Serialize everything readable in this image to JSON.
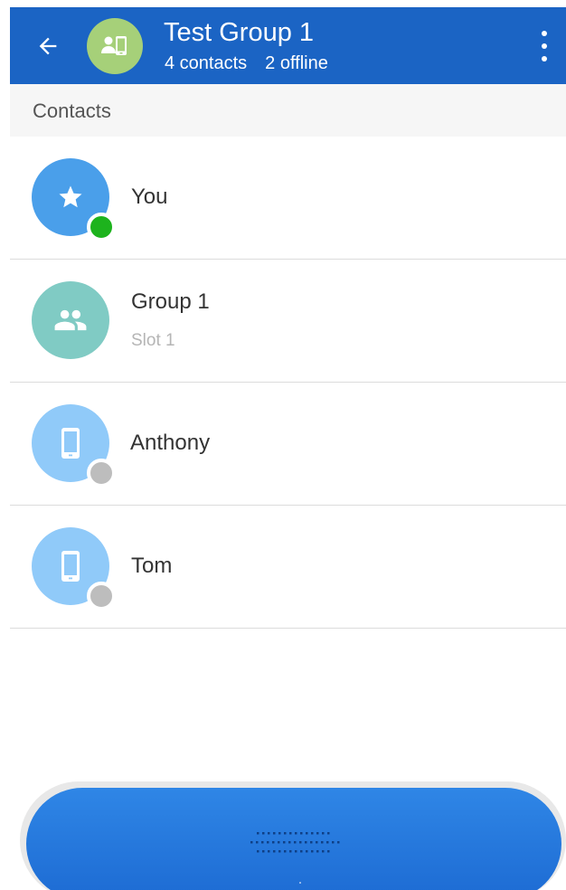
{
  "header": {
    "title": "Test Group 1",
    "contacts_count": "4 contacts",
    "offline_count": "2 offline",
    "group_avatar_color": "#a6d079",
    "background_color": "#1b64c4"
  },
  "section": {
    "label": "Contacts"
  },
  "contacts": [
    {
      "name": "You",
      "subtitle": "",
      "icon": "star-icon",
      "avatar_color": "#4a9fea",
      "status": "online",
      "status_color": "#1db31d"
    },
    {
      "name": "Group 1",
      "subtitle": "Slot 1",
      "icon": "group-icon",
      "avatar_color": "#80cbc4",
      "status": "",
      "status_color": ""
    },
    {
      "name": "Anthony",
      "subtitle": "",
      "icon": "phone-icon",
      "avatar_color": "#90caf9",
      "status": "offline",
      "status_color": "#bdbdbd"
    },
    {
      "name": "Tom",
      "subtitle": "",
      "icon": "phone-icon",
      "avatar_color": "#90caf9",
      "status": "offline",
      "status_color": "#bdbdbd"
    }
  ],
  "ptt": {
    "button_color": "#1d6bd3"
  }
}
